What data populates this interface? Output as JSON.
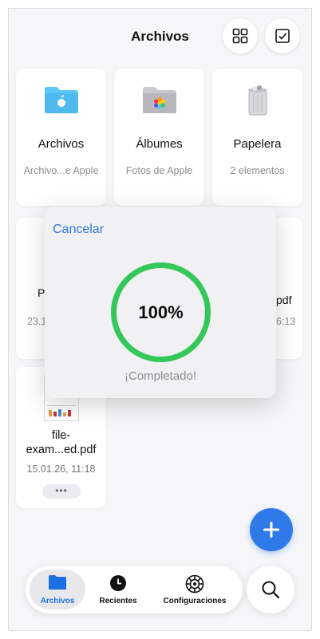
{
  "header": {
    "title": "Archivos"
  },
  "top_cards": [
    {
      "name": "Archivos",
      "subtitle": "Archivo...e Apple"
    },
    {
      "name": "Álbumes",
      "subtitle": "Fotos de Apple"
    },
    {
      "name": "Papelera",
      "subtitle": "2 elementos"
    }
  ],
  "partial_row": {
    "left_name": "P",
    "left_sub": "23.1",
    "right_name": "pdf",
    "right_sub": "6:13"
  },
  "file_card": {
    "name": "file-\nexam...ed.pdf",
    "date": "15.01.26, 11:18",
    "more": "•••"
  },
  "dialog": {
    "cancel_label": "Cancelar",
    "progress_text": "100%",
    "progress": 1.0,
    "status": "¡Completado!"
  },
  "tabs": [
    {
      "label": "Archivos",
      "active": true
    },
    {
      "label": "Recientes",
      "active": false
    },
    {
      "label": "Configuraciones",
      "active": false
    }
  ],
  "colors": {
    "accent": "#2f7ae8",
    "progress_ring": "#34c759",
    "folder_blue": "#5ac8fa"
  }
}
